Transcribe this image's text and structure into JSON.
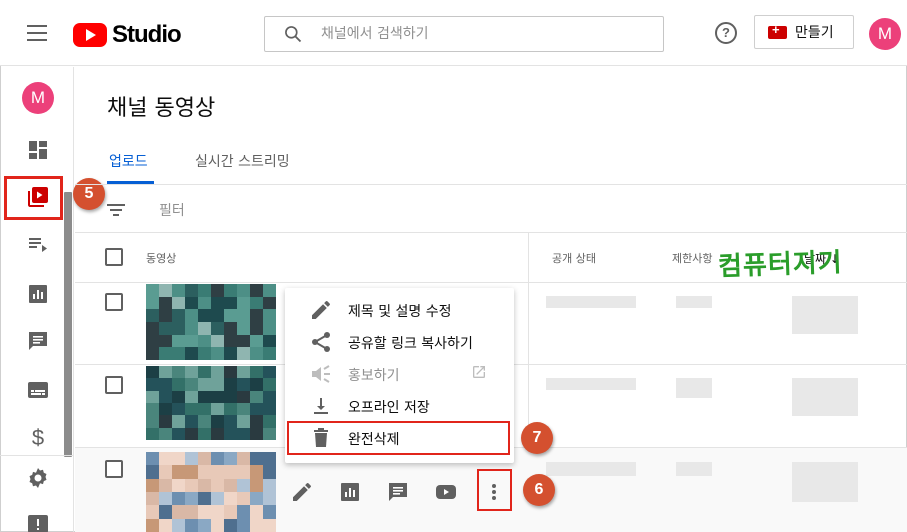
{
  "header": {
    "logo_text": "Studio",
    "search_placeholder": "채널에서 검색하기",
    "help_glyph": "?",
    "create_label": "만들기",
    "avatar_letter": "M"
  },
  "sidebar": {
    "avatar_letter": "M",
    "items": [
      "dashboard",
      "content",
      "playlists",
      "analytics",
      "comments",
      "subtitles",
      "monetization",
      "settings",
      "feedback"
    ],
    "active_item": "content"
  },
  "page": {
    "title": "채널 동영상",
    "tabs": [
      {
        "label": "업로드",
        "active": true
      },
      {
        "label": "실시간 스트리밍",
        "active": false
      }
    ],
    "filter_label": "필터"
  },
  "table": {
    "columns": {
      "video": "동영상",
      "visibility": "공개 상태",
      "restrictions": "제한사항",
      "date": "날짜",
      "sort_arrow": "↓"
    },
    "row_count": 3
  },
  "context_menu": {
    "items": [
      {
        "label": "제목 및 설명 수정",
        "icon": "pencil-icon",
        "enabled": true
      },
      {
        "label": "공유할 링크 복사하기",
        "icon": "share-icon",
        "enabled": true
      },
      {
        "label": "홍보하기",
        "icon": "megaphone-icon",
        "enabled": false
      },
      {
        "label": "오프라인 저장",
        "icon": "download-icon",
        "enabled": true
      },
      {
        "label": "완전삭제",
        "icon": "trash-icon",
        "enabled": true
      }
    ]
  },
  "row_actions": [
    "pencil-icon",
    "analytics-icon",
    "comments-icon",
    "youtube-icon",
    "more-vert-icon"
  ],
  "markers": {
    "m5": "5",
    "m6": "6",
    "m7": "7"
  },
  "watermark": "컴퓨터지기",
  "colors": {
    "brand_red": "#ff0000",
    "link_blue": "#065fd4",
    "marker": "#d4502f",
    "highlight": "#e1251b",
    "avatar": "#ec407a",
    "watermark": "#2a9d2a"
  }
}
